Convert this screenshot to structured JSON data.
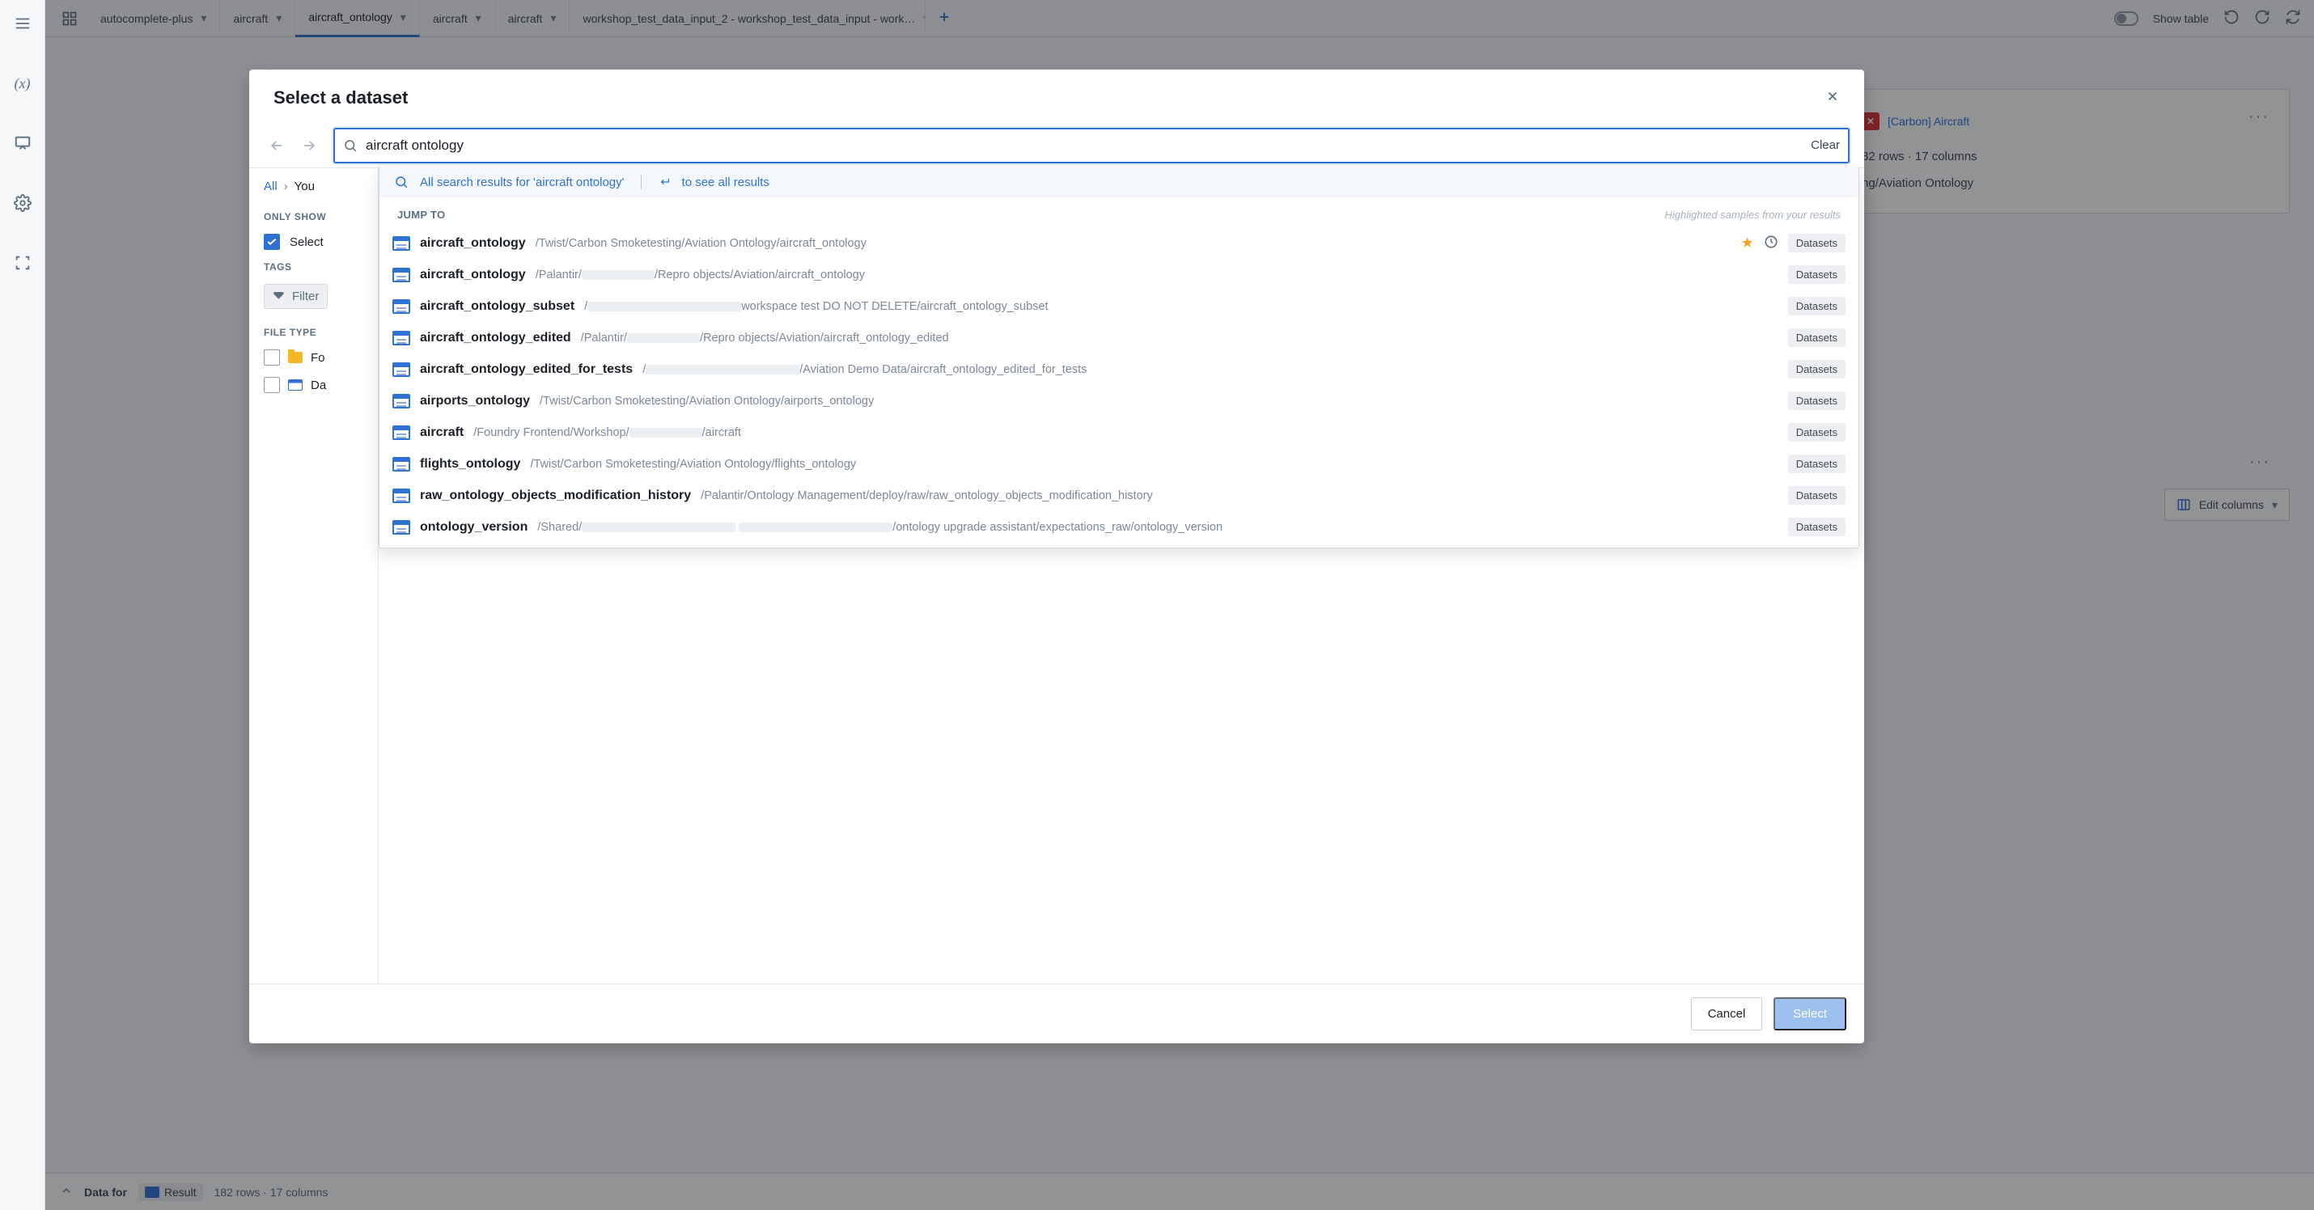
{
  "tabs": [
    {
      "label": "autocomplete-plus"
    },
    {
      "label": "aircraft"
    },
    {
      "label": "aircraft_ontology",
      "active": true
    },
    {
      "label": "aircraft"
    },
    {
      "label": "aircraft"
    },
    {
      "label": "workshop_test_data_input_2 - workshop_test_data_input - work…"
    }
  ],
  "toolbar_right": {
    "show_table": "Show table"
  },
  "leftrail": {
    "menu": "menu",
    "vars": "(x)",
    "preview": "preview",
    "settings": "settings",
    "frame": "frame"
  },
  "bg": {
    "carbon_aircraft": "[Carbon] Aircraft",
    "rows_cols": "82 rows  ·  17 columns",
    "path_tail": "ng/Aviation Ontology",
    "more": "···",
    "edit_columns": "Edit columns"
  },
  "modal": {
    "title": "Select a dataset",
    "search_value": "aircraft ontology",
    "clear": "Clear",
    "crumbs": {
      "all": "All",
      "you": "You"
    },
    "only_show": "ONLY SHOW",
    "select": "Select",
    "tags": "TAGS",
    "filter": "Filter",
    "file_type": "FILE TYPE",
    "file_folder": "Fo",
    "file_dataset": "Da",
    "searchline_prefix": "All search results for '",
    "searchline_query": "aircraft ontology",
    "searchline_suffix": "'",
    "see_all": "to see all results",
    "jump_to": "JUMP TO",
    "highlighted": "Highlighted samples from your results",
    "badge": "Datasets",
    "cancel": "Cancel",
    "select_btn": "Select",
    "results": [
      {
        "name": "aircraft_ontology",
        "path": "/Twist/Carbon Smoketesting/Aviation Ontology/aircraft_ontology",
        "star": true,
        "recent": true
      },
      {
        "name": "aircraft_ontology",
        "path": "/Palantir/",
        "redact": true,
        "path_tail": "/Repro objects/Aviation/aircraft_ontology"
      },
      {
        "name": "aircraft_ontology_subset",
        "path": "/",
        "redact_long": true,
        "path_tail": "workspace test DO NOT DELETE/aircraft_ontology_subset"
      },
      {
        "name": "aircraft_ontology_edited",
        "path": "/Palantir/",
        "redact": true,
        "path_tail": "/Repro objects/Aviation/aircraft_ontology_edited"
      },
      {
        "name": "aircraft_ontology_edited_for_tests",
        "path": "/",
        "redact_long": true,
        "path_tail": "/Aviation Demo Data/aircraft_ontology_edited_for_tests"
      },
      {
        "name": "airports_ontology",
        "path": "/Twist/Carbon Smoketesting/Aviation Ontology/airports_ontology"
      },
      {
        "name": "aircraft",
        "path": "/Foundry Frontend/Workshop/",
        "redact": true,
        "path_tail": "/aircraft",
        "redact_short": true
      },
      {
        "name": "flights_ontology",
        "path": "/Twist/Carbon Smoketesting/Aviation Ontology/flights_ontology"
      },
      {
        "name": "raw_ontology_objects_modification_history",
        "path": "/Palantir/Ontology Management/deploy/raw/raw_ontology_objects_modification_history"
      },
      {
        "name": "ontology_version",
        "path": "/Shared/",
        "redact_long": true,
        "redact_extra": true,
        "path_tail": "/ontology upgrade assistant/expectations_raw/ontology_version"
      }
    ]
  },
  "status": {
    "data_for": "Data for",
    "result": "Result",
    "dims": "182 rows  ·  17 columns"
  }
}
